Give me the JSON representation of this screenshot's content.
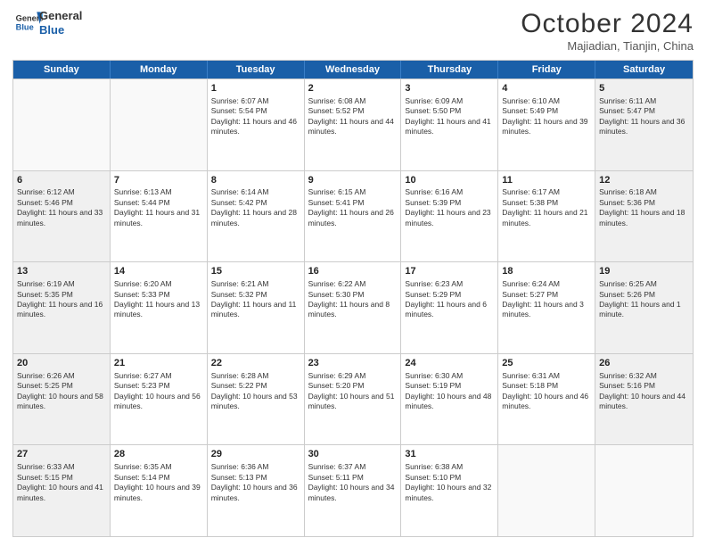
{
  "header": {
    "logo_general": "General",
    "logo_blue": "Blue",
    "month_title": "October 2024",
    "subtitle": "Majiadian, Tianjin, China"
  },
  "days_of_week": [
    "Sunday",
    "Monday",
    "Tuesday",
    "Wednesday",
    "Thursday",
    "Friday",
    "Saturday"
  ],
  "weeks": [
    [
      {
        "day": "",
        "sunrise": "",
        "sunset": "",
        "daylight": "",
        "empty": true
      },
      {
        "day": "",
        "sunrise": "",
        "sunset": "",
        "daylight": "",
        "empty": true
      },
      {
        "day": "1",
        "sunrise": "Sunrise: 6:07 AM",
        "sunset": "Sunset: 5:54 PM",
        "daylight": "Daylight: 11 hours and 46 minutes.",
        "empty": false
      },
      {
        "day": "2",
        "sunrise": "Sunrise: 6:08 AM",
        "sunset": "Sunset: 5:52 PM",
        "daylight": "Daylight: 11 hours and 44 minutes.",
        "empty": false
      },
      {
        "day": "3",
        "sunrise": "Sunrise: 6:09 AM",
        "sunset": "Sunset: 5:50 PM",
        "daylight": "Daylight: 11 hours and 41 minutes.",
        "empty": false
      },
      {
        "day": "4",
        "sunrise": "Sunrise: 6:10 AM",
        "sunset": "Sunset: 5:49 PM",
        "daylight": "Daylight: 11 hours and 39 minutes.",
        "empty": false
      },
      {
        "day": "5",
        "sunrise": "Sunrise: 6:11 AM",
        "sunset": "Sunset: 5:47 PM",
        "daylight": "Daylight: 11 hours and 36 minutes.",
        "empty": false
      }
    ],
    [
      {
        "day": "6",
        "sunrise": "Sunrise: 6:12 AM",
        "sunset": "Sunset: 5:46 PM",
        "daylight": "Daylight: 11 hours and 33 minutes.",
        "empty": false
      },
      {
        "day": "7",
        "sunrise": "Sunrise: 6:13 AM",
        "sunset": "Sunset: 5:44 PM",
        "daylight": "Daylight: 11 hours and 31 minutes.",
        "empty": false
      },
      {
        "day": "8",
        "sunrise": "Sunrise: 6:14 AM",
        "sunset": "Sunset: 5:42 PM",
        "daylight": "Daylight: 11 hours and 28 minutes.",
        "empty": false
      },
      {
        "day": "9",
        "sunrise": "Sunrise: 6:15 AM",
        "sunset": "Sunset: 5:41 PM",
        "daylight": "Daylight: 11 hours and 26 minutes.",
        "empty": false
      },
      {
        "day": "10",
        "sunrise": "Sunrise: 6:16 AM",
        "sunset": "Sunset: 5:39 PM",
        "daylight": "Daylight: 11 hours and 23 minutes.",
        "empty": false
      },
      {
        "day": "11",
        "sunrise": "Sunrise: 6:17 AM",
        "sunset": "Sunset: 5:38 PM",
        "daylight": "Daylight: 11 hours and 21 minutes.",
        "empty": false
      },
      {
        "day": "12",
        "sunrise": "Sunrise: 6:18 AM",
        "sunset": "Sunset: 5:36 PM",
        "daylight": "Daylight: 11 hours and 18 minutes.",
        "empty": false
      }
    ],
    [
      {
        "day": "13",
        "sunrise": "Sunrise: 6:19 AM",
        "sunset": "Sunset: 5:35 PM",
        "daylight": "Daylight: 11 hours and 16 minutes.",
        "empty": false
      },
      {
        "day": "14",
        "sunrise": "Sunrise: 6:20 AM",
        "sunset": "Sunset: 5:33 PM",
        "daylight": "Daylight: 11 hours and 13 minutes.",
        "empty": false
      },
      {
        "day": "15",
        "sunrise": "Sunrise: 6:21 AM",
        "sunset": "Sunset: 5:32 PM",
        "daylight": "Daylight: 11 hours and 11 minutes.",
        "empty": false
      },
      {
        "day": "16",
        "sunrise": "Sunrise: 6:22 AM",
        "sunset": "Sunset: 5:30 PM",
        "daylight": "Daylight: 11 hours and 8 minutes.",
        "empty": false
      },
      {
        "day": "17",
        "sunrise": "Sunrise: 6:23 AM",
        "sunset": "Sunset: 5:29 PM",
        "daylight": "Daylight: 11 hours and 6 minutes.",
        "empty": false
      },
      {
        "day": "18",
        "sunrise": "Sunrise: 6:24 AM",
        "sunset": "Sunset: 5:27 PM",
        "daylight": "Daylight: 11 hours and 3 minutes.",
        "empty": false
      },
      {
        "day": "19",
        "sunrise": "Sunrise: 6:25 AM",
        "sunset": "Sunset: 5:26 PM",
        "daylight": "Daylight: 11 hours and 1 minute.",
        "empty": false
      }
    ],
    [
      {
        "day": "20",
        "sunrise": "Sunrise: 6:26 AM",
        "sunset": "Sunset: 5:25 PM",
        "daylight": "Daylight: 10 hours and 58 minutes.",
        "empty": false
      },
      {
        "day": "21",
        "sunrise": "Sunrise: 6:27 AM",
        "sunset": "Sunset: 5:23 PM",
        "daylight": "Daylight: 10 hours and 56 minutes.",
        "empty": false
      },
      {
        "day": "22",
        "sunrise": "Sunrise: 6:28 AM",
        "sunset": "Sunset: 5:22 PM",
        "daylight": "Daylight: 10 hours and 53 minutes.",
        "empty": false
      },
      {
        "day": "23",
        "sunrise": "Sunrise: 6:29 AM",
        "sunset": "Sunset: 5:20 PM",
        "daylight": "Daylight: 10 hours and 51 minutes.",
        "empty": false
      },
      {
        "day": "24",
        "sunrise": "Sunrise: 6:30 AM",
        "sunset": "Sunset: 5:19 PM",
        "daylight": "Daylight: 10 hours and 48 minutes.",
        "empty": false
      },
      {
        "day": "25",
        "sunrise": "Sunrise: 6:31 AM",
        "sunset": "Sunset: 5:18 PM",
        "daylight": "Daylight: 10 hours and 46 minutes.",
        "empty": false
      },
      {
        "day": "26",
        "sunrise": "Sunrise: 6:32 AM",
        "sunset": "Sunset: 5:16 PM",
        "daylight": "Daylight: 10 hours and 44 minutes.",
        "empty": false
      }
    ],
    [
      {
        "day": "27",
        "sunrise": "Sunrise: 6:33 AM",
        "sunset": "Sunset: 5:15 PM",
        "daylight": "Daylight: 10 hours and 41 minutes.",
        "empty": false
      },
      {
        "day": "28",
        "sunrise": "Sunrise: 6:35 AM",
        "sunset": "Sunset: 5:14 PM",
        "daylight": "Daylight: 10 hours and 39 minutes.",
        "empty": false
      },
      {
        "day": "29",
        "sunrise": "Sunrise: 6:36 AM",
        "sunset": "Sunset: 5:13 PM",
        "daylight": "Daylight: 10 hours and 36 minutes.",
        "empty": false
      },
      {
        "day": "30",
        "sunrise": "Sunrise: 6:37 AM",
        "sunset": "Sunset: 5:11 PM",
        "daylight": "Daylight: 10 hours and 34 minutes.",
        "empty": false
      },
      {
        "day": "31",
        "sunrise": "Sunrise: 6:38 AM",
        "sunset": "Sunset: 5:10 PM",
        "daylight": "Daylight: 10 hours and 32 minutes.",
        "empty": false
      },
      {
        "day": "",
        "sunrise": "",
        "sunset": "",
        "daylight": "",
        "empty": true
      },
      {
        "day": "",
        "sunrise": "",
        "sunset": "",
        "daylight": "",
        "empty": true
      }
    ]
  ]
}
